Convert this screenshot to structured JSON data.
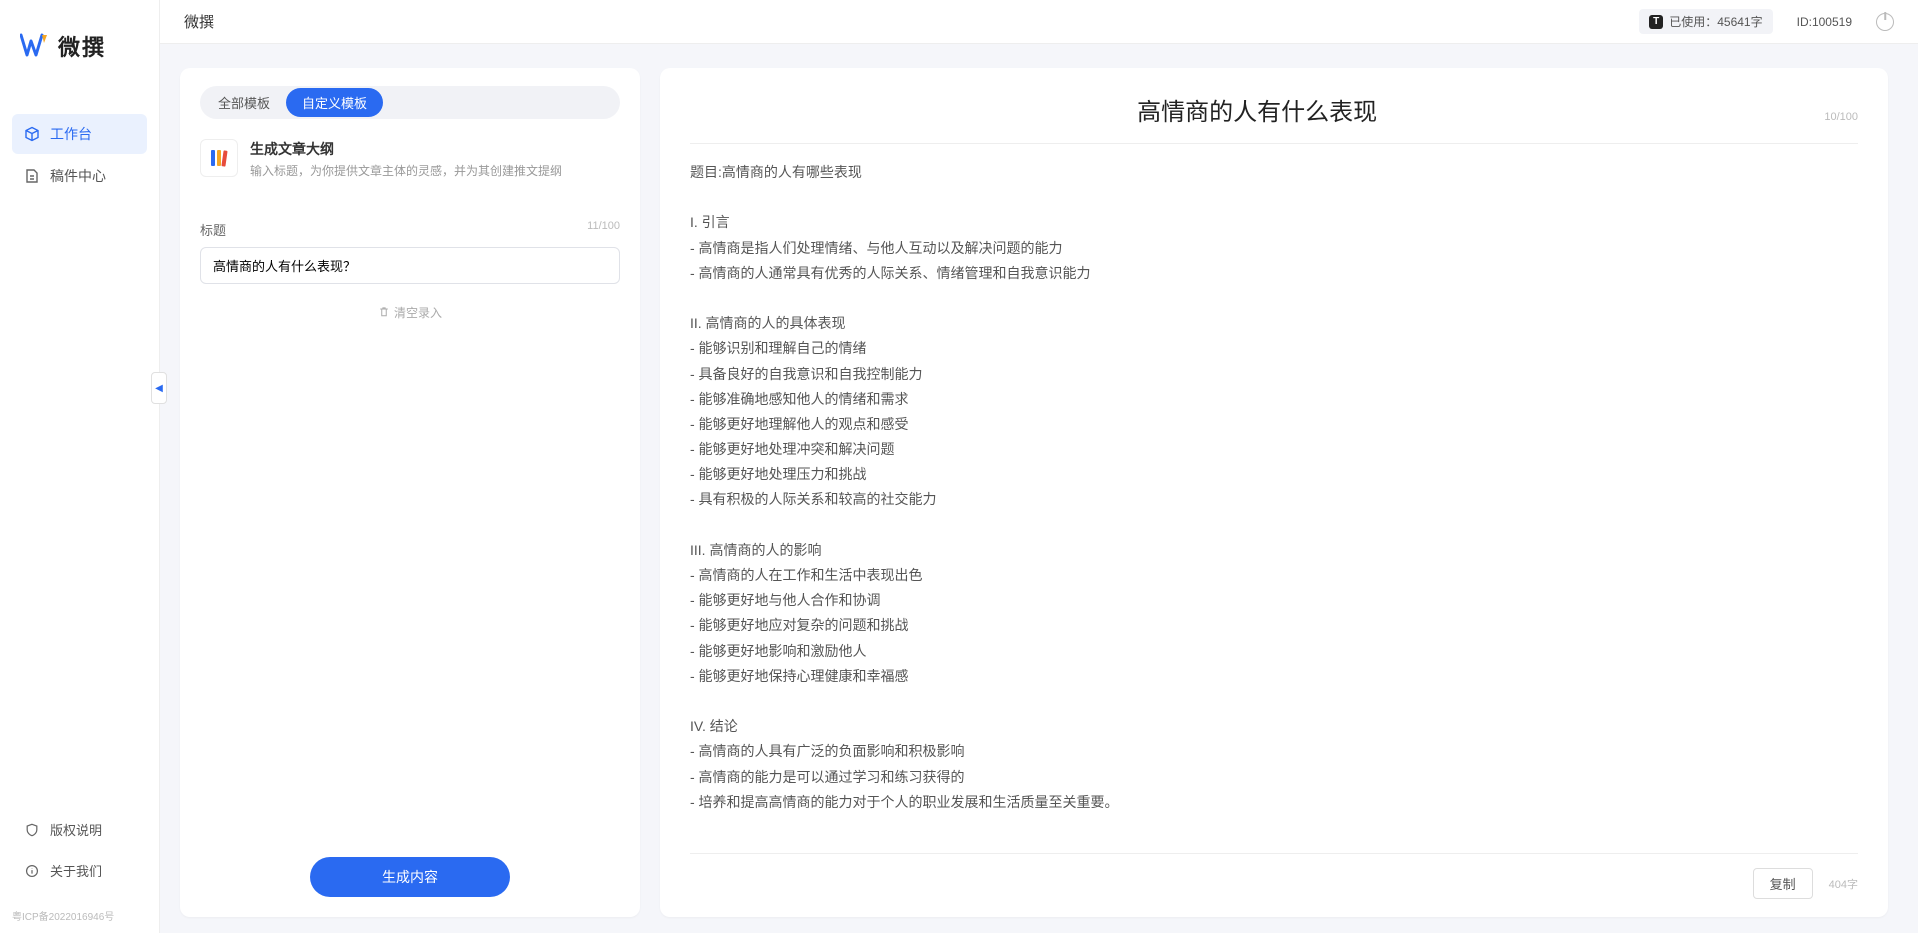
{
  "brand": {
    "name": "微撰"
  },
  "topbar": {
    "title": "微撰",
    "usage_label": "已使用：45641字",
    "id_label": "ID:100519"
  },
  "sidebar": {
    "items": [
      {
        "label": "工作台",
        "active": true
      },
      {
        "label": "稿件中心",
        "active": false
      }
    ],
    "bottom": [
      {
        "label": "版权说明"
      },
      {
        "label": "关于我们"
      }
    ],
    "icp": "粤ICP备2022016946号"
  },
  "left_panel": {
    "tabs": [
      {
        "label": "全部模板",
        "active": false
      },
      {
        "label": "自定义模板",
        "active": true
      }
    ],
    "template": {
      "title": "生成文章大纲",
      "desc": "输入标题，为你提供文章主体的灵感，并为其创建推文提纲"
    },
    "field": {
      "label": "标题",
      "counter": "11/100",
      "value": "高情商的人有什么表现？"
    },
    "clear_label": "清空录入",
    "generate_label": "生成内容"
  },
  "right_panel": {
    "title": "高情商的人有什么表现",
    "title_counter": "10/100",
    "body": "题目:高情商的人有哪些表现\n\nI. 引言\n- 高情商是指人们处理情绪、与他人互动以及解决问题的能力\n- 高情商的人通常具有优秀的人际关系、情绪管理和自我意识能力\n\nII. 高情商的人的具体表现\n- 能够识别和理解自己的情绪\n- 具备良好的自我意识和自我控制能力\n- 能够准确地感知他人的情绪和需求\n- 能够更好地理解他人的观点和感受\n- 能够更好地处理冲突和解决问题\n- 能够更好地处理压力和挑战\n- 具有积极的人际关系和较高的社交能力\n\nIII. 高情商的人的影响\n- 高情商的人在工作和生活中表现出色\n- 能够更好地与他人合作和协调\n- 能够更好地应对复杂的问题和挑战\n- 能够更好地影响和激励他人\n- 能够更好地保持心理健康和幸福感\n\nIV. 结论\n- 高情商的人具有广泛的负面影响和积极影响\n- 高情商的能力是可以通过学习和练习获得的\n- 培养和提高高情商的能力对于个人的职业发展和生活质量至关重要。",
    "copy_label": "复制",
    "char_count": "404字"
  }
}
